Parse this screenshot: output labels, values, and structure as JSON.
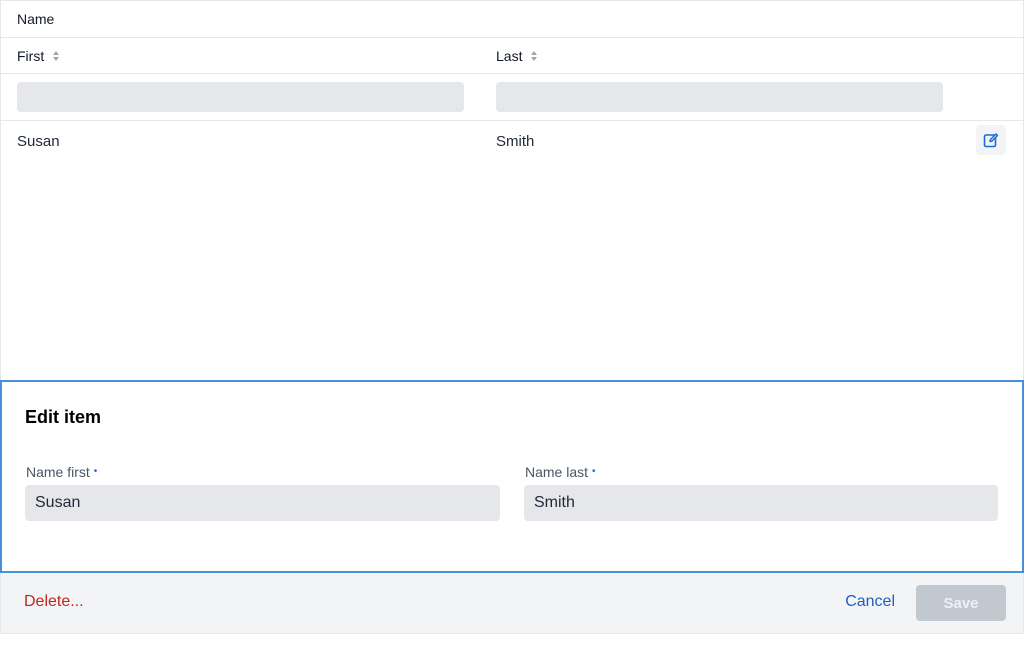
{
  "grid": {
    "group_header": "Name",
    "columns": [
      {
        "label": "First"
      },
      {
        "label": "Last"
      }
    ],
    "filters": {
      "first": {
        "value": "",
        "placeholder": ""
      },
      "last": {
        "value": "",
        "placeholder": ""
      }
    },
    "rows": [
      {
        "first": "Susan",
        "last": "Smith"
      }
    ],
    "edit_icon": "edit-icon"
  },
  "editor": {
    "title": "Edit item",
    "fields": {
      "first": {
        "label": "Name first",
        "value": "Susan"
      },
      "last": {
        "label": "Name last",
        "value": "Smith"
      }
    },
    "required_marker": "•"
  },
  "footer": {
    "delete_label": "Delete...",
    "cancel_label": "Cancel",
    "save_label": "Save"
  },
  "colors": {
    "accent": "#4a90d9",
    "link": "#1d5fc2",
    "danger": "#c0271b",
    "disabled": "#c2c8d0"
  }
}
